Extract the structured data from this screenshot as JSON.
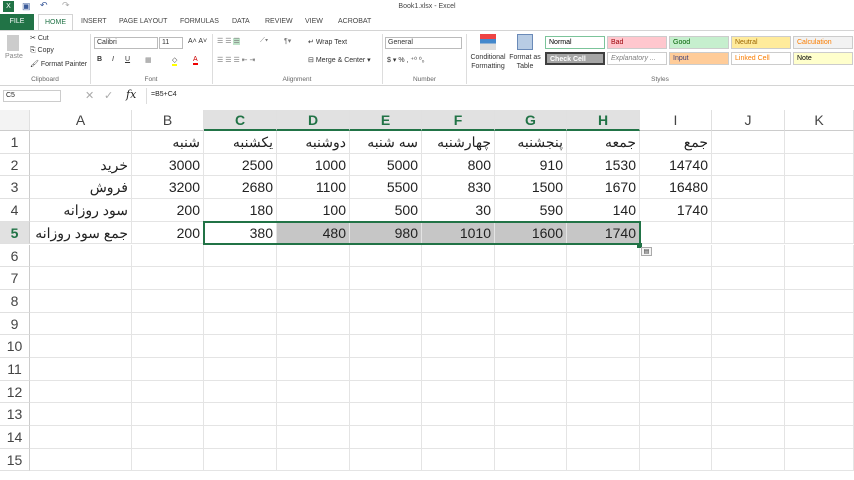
{
  "window": {
    "title": "Book1.xlsx - Excel"
  },
  "tabs": [
    "FILE",
    "HOME",
    "INSERT",
    "PAGE LAYOUT",
    "FORMULAS",
    "DATA",
    "REVIEW",
    "VIEW",
    "ACROBAT"
  ],
  "ribbon": {
    "clipboard": {
      "paste": "Paste",
      "cut": "Cut",
      "copy": "Copy",
      "format_painter": "Format Painter",
      "label": "Clipboard"
    },
    "font": {
      "name": "Calibri",
      "size": "11",
      "label": "Font",
      "bold": "B",
      "italic": "I",
      "underline": "U"
    },
    "alignment": {
      "wrap": "Wrap Text",
      "merge": "Merge & Center",
      "label": "Alignment"
    },
    "number": {
      "format": "General",
      "currency": "$",
      "percent": "%",
      "comma": ",",
      "label": "Number"
    },
    "styles": {
      "conditional": "Conditional Formatting",
      "format_table": "Format as Table",
      "label": "Styles",
      "cells": [
        {
          "name": "Normal",
          "bg": "#ffffff",
          "fg": "#000000"
        },
        {
          "name": "Bad",
          "bg": "#ffc7ce",
          "fg": "#9c0006"
        },
        {
          "name": "Good",
          "bg": "#c6efce",
          "fg": "#006100"
        },
        {
          "name": "Neutral",
          "bg": "#ffeb9c",
          "fg": "#9c6500"
        },
        {
          "name": "Calculation",
          "bg": "#f2f2f2",
          "fg": "#fa7d00"
        },
        {
          "name": "Check Cell",
          "bg": "#a5a5a5",
          "fg": "#ffffff"
        },
        {
          "name": "Explanatory ...",
          "bg": "#ffffff",
          "fg": "#7f7f7f"
        },
        {
          "name": "Input",
          "bg": "#ffcc99",
          "fg": "#3f3f76"
        },
        {
          "name": "Linked Cell",
          "bg": "#ffffff",
          "fg": "#fa7d00"
        },
        {
          "name": "Note",
          "bg": "#ffffcc",
          "fg": "#000000"
        }
      ]
    }
  },
  "formula_bar": {
    "name_box": "C5",
    "fx": "fx",
    "formula": "=B5+C4"
  },
  "grid": {
    "columns": [
      "A",
      "B",
      "C",
      "D",
      "E",
      "F",
      "G",
      "H",
      "I",
      "J",
      "K"
    ],
    "selected_columns": [
      "C",
      "D",
      "E",
      "F",
      "G",
      "H"
    ],
    "rows": [
      "1",
      "2",
      "3",
      "4",
      "5",
      "6",
      "7",
      "8",
      "9",
      "10",
      "11",
      "12",
      "13",
      "14",
      "15"
    ],
    "selected_row": "5",
    "cells": [
      [
        "",
        "شنبه",
        "یکشنبه",
        "دوشنبه",
        "سه شنبه",
        "چهارشنبه",
        "پنجشنبه",
        "جمعه",
        "جمع",
        "",
        ""
      ],
      [
        "خرید",
        "3000",
        "2500",
        "1000",
        "5000",
        "800",
        "910",
        "1530",
        "14740",
        "",
        ""
      ],
      [
        "فروش",
        "3200",
        "2680",
        "1100",
        "5500",
        "830",
        "1500",
        "1670",
        "16480",
        "",
        ""
      ],
      [
        "سود روزانه",
        "200",
        "180",
        "100",
        "500",
        "30",
        "590",
        "140",
        "1740",
        "",
        ""
      ],
      [
        "جمع سود روزانه",
        "200",
        "380",
        "480",
        "980",
        "1010",
        "1600",
        "1740",
        "",
        "",
        ""
      ]
    ]
  },
  "accent": "#217346"
}
